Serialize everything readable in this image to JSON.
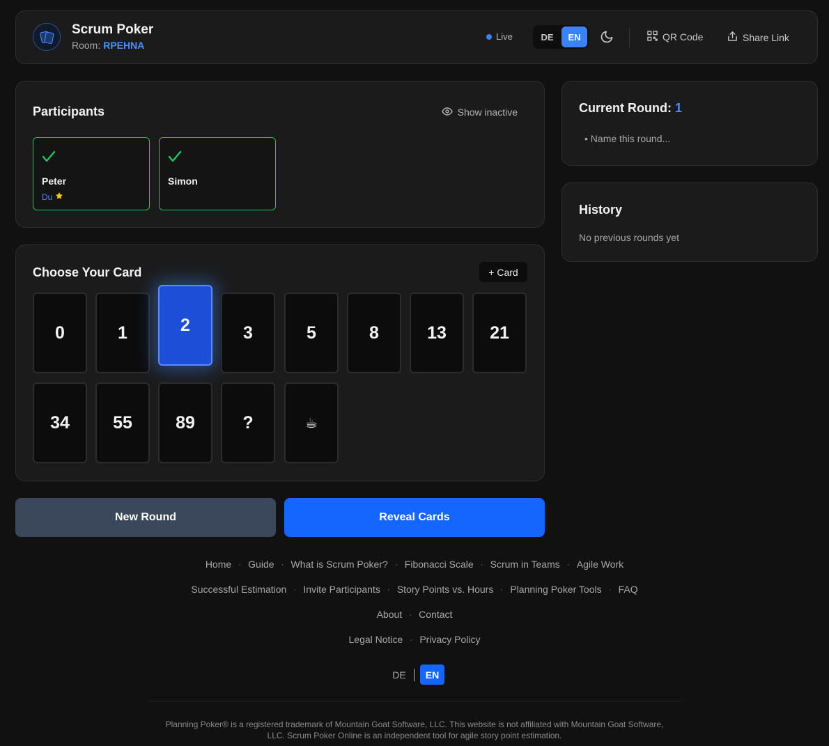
{
  "header": {
    "app_title": "Scrum Poker",
    "room_label": "Room:",
    "room_code": "RPEHNA",
    "status": "Live",
    "languages": [
      "DE",
      "EN"
    ],
    "active_language": "EN",
    "qr_label": "QR Code",
    "share_label": "Share Link",
    "icons": {
      "logo": "cards-logo-icon",
      "theme": "moon-icon",
      "qr": "qr-code-icon",
      "share": "share-icon"
    }
  },
  "participants": {
    "title": "Participants",
    "show_inactive_label": "Show inactive",
    "list": [
      {
        "name": "Peter",
        "voted": true,
        "is_you": true,
        "you_label": "Du"
      },
      {
        "name": "Simon",
        "voted": true,
        "is_you": false
      }
    ]
  },
  "cards": {
    "title": "Choose Your Card",
    "add_label": "+ Card",
    "values": [
      "0",
      "1",
      "2",
      "3",
      "5",
      "8",
      "13",
      "21",
      "34",
      "55",
      "89",
      "?",
      "☕"
    ],
    "selected": "2"
  },
  "actions": {
    "new_round": "New Round",
    "reveal": "Reveal Cards"
  },
  "round": {
    "title": "Current Round:",
    "number": "1",
    "name_placeholder": "• Name this round..."
  },
  "history": {
    "title": "History",
    "empty_text": "No previous rounds yet"
  },
  "footer": {
    "rows": [
      [
        "Home",
        "Guide",
        "What is Scrum Poker?",
        "Fibonacci Scale",
        "Scrum in Teams",
        "Agile Work"
      ],
      [
        "Successful Estimation",
        "Invite Participants",
        "Story Points vs. Hours",
        "Planning Poker Tools",
        "FAQ"
      ],
      [
        "About",
        "Contact"
      ],
      [
        "Legal Notice",
        "Privacy Policy"
      ]
    ],
    "languages": [
      "DE",
      "EN"
    ],
    "active_language": "EN",
    "disclaimer": "Planning Poker® is a registered trademark of Mountain Goat Software, LLC. This website is not affiliated with Mountain Goat Software, LLC. Scrum Poker Online is an independent tool for agile story point estimation."
  },
  "colors": {
    "background": "#111111",
    "panel": "#1b1b1b",
    "accent": "#3b82f6",
    "primary_button": "#1565ff",
    "secondary_button": "#3b475b",
    "voted_border": "#22c55e"
  }
}
